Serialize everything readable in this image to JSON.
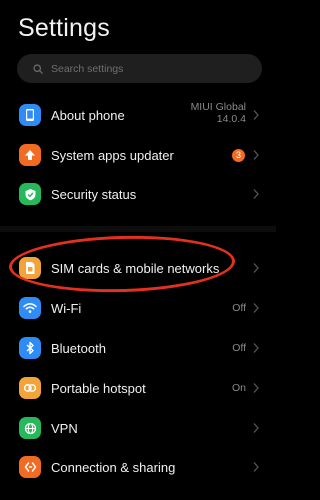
{
  "header": {
    "title": "Settings"
  },
  "search": {
    "placeholder": "Search settings"
  },
  "items": [
    {
      "label": "About phone",
      "value_line1": "MIUI Global",
      "value_line2": "14.0.4",
      "icon": "phone-icon",
      "color": "#2f8cf5"
    },
    {
      "label": "System apps updater",
      "badge": "3",
      "icon": "upload-arrow-icon",
      "color": "#f26b22"
    },
    {
      "label": "Security status",
      "icon": "shield-check-icon",
      "color": "#26b85a"
    },
    {
      "label": "SIM cards & mobile networks",
      "icon": "sim-card-icon",
      "color": "#f2a33a"
    },
    {
      "label": "Wi-Fi",
      "value": "Off",
      "icon": "wifi-icon",
      "color": "#2f8cf5"
    },
    {
      "label": "Bluetooth",
      "value": "Off",
      "icon": "bluetooth-icon",
      "color": "#2f8cf5"
    },
    {
      "label": "Portable hotspot",
      "value": "On",
      "icon": "hotspot-icon",
      "color": "#f2a33a"
    },
    {
      "label": "VPN",
      "icon": "vpn-globe-icon",
      "color": "#26b85a"
    },
    {
      "label": "Connection & sharing",
      "icon": "sharing-icon",
      "color": "#f26b22"
    }
  ],
  "annotation": {
    "shape": "ellipse",
    "color": "#e3301f",
    "target": "SIM cards & mobile networks"
  }
}
